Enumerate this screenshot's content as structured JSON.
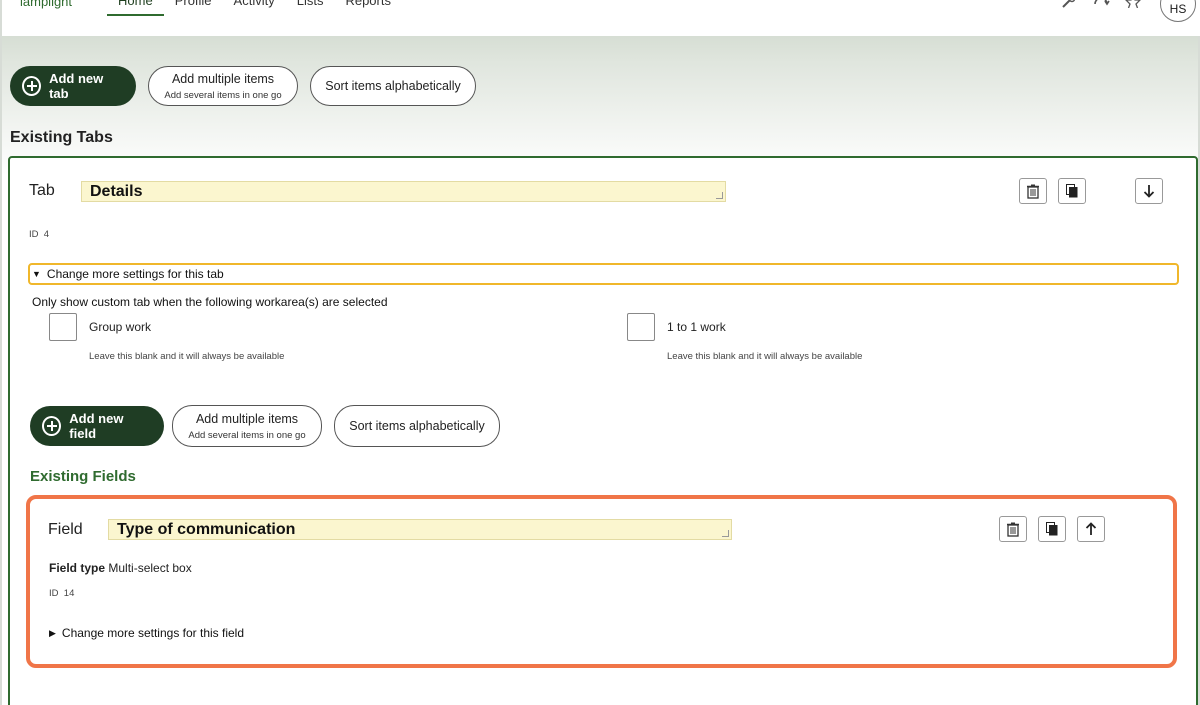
{
  "nav": {
    "brand": "lamplight",
    "links": [
      "Home",
      "Profile",
      "Activity",
      "Lists",
      "Reports"
    ],
    "active": "Home",
    "avatar_initials": "HS",
    "icons": [
      "wrench-icon",
      "sync-icon",
      "star-icon"
    ]
  },
  "toolbar": {
    "add_tab_label": "Add new tab",
    "add_multiple_label": "Add multiple items",
    "add_multiple_sub": "Add several items in one go",
    "sort_label": "Sort items alphabetically"
  },
  "existing_tabs_heading": "Existing Tabs",
  "tab": {
    "label": "Tab",
    "name": "Details",
    "id_label": "ID",
    "id_value": "4",
    "more_settings": "Change more settings for this tab",
    "workarea_title": "Only show custom tab when the following workarea(s) are selected",
    "workareas": [
      {
        "label": "Group work",
        "help": "Leave this blank and it will always be available",
        "checked": false
      },
      {
        "label": "1 to 1 work",
        "help": "Leave this blank and it will always be available",
        "checked": false
      }
    ],
    "add_field_label": "Add new field",
    "add_multiple_label": "Add multiple items",
    "add_multiple_sub": "Add several items in one go",
    "sort_label": "Sort items alphabetically",
    "existing_fields_heading": "Existing Fields"
  },
  "field": {
    "label": "Field",
    "name": "Type of communication",
    "type_label": "Field type",
    "type_value": "Multi-select box",
    "id_label": "ID",
    "id_value": "14",
    "more_settings": "Change more settings for this field"
  },
  "colors": {
    "primary": "#1f3d24",
    "accent_green": "#2f6b2f",
    "highlight_orange": "#f07548",
    "focus_yellow": "#f0b72b",
    "name_field_bg": "#fbf6cf"
  }
}
